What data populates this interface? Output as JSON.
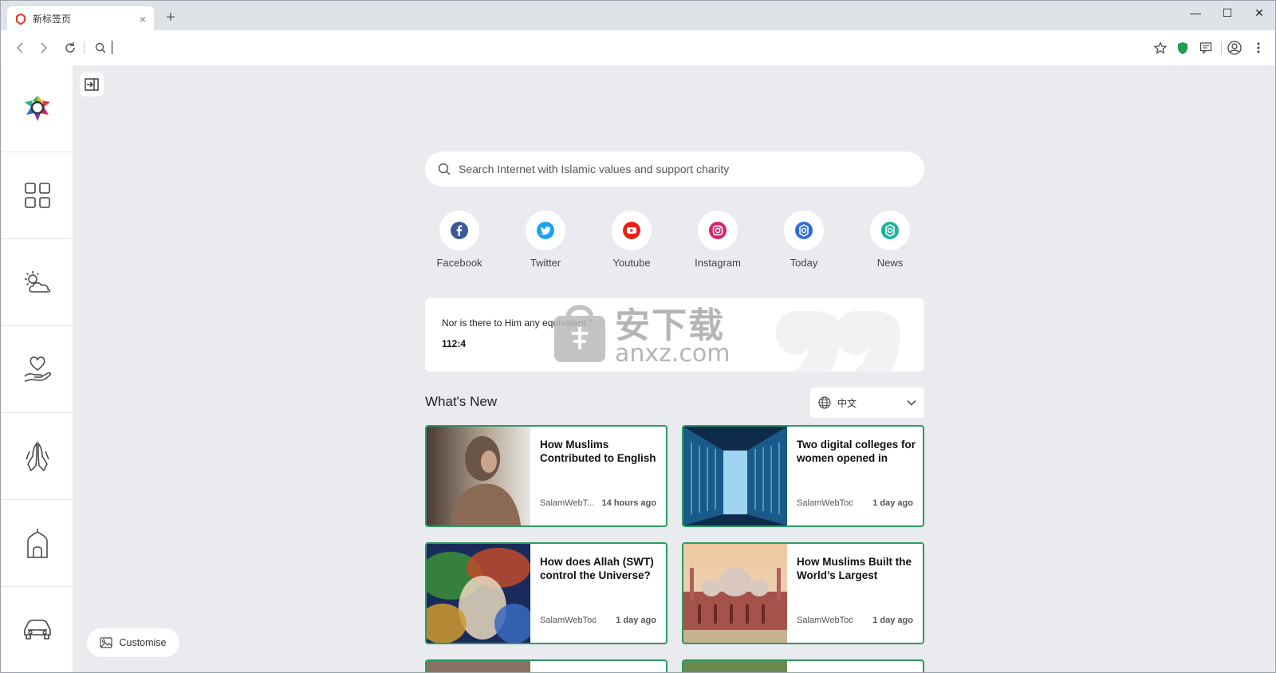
{
  "browser": {
    "tab_title": "新标签页",
    "tab_close": "×",
    "new_tab": "+",
    "window_controls": {
      "minimize": "—",
      "maximize": "☐",
      "close": "✕"
    },
    "address_value": ""
  },
  "toolbar_icons": [
    "back-icon",
    "forward-icon",
    "reload-icon",
    "search-icon",
    "star-icon",
    "shield-icon",
    "chat-icon",
    "account-icon",
    "menu-icon"
  ],
  "sidebar": {
    "items": [
      {
        "name": "logo",
        "icon": "salam-logo-icon"
      },
      {
        "name": "apps",
        "icon": "grid-icon"
      },
      {
        "name": "weather",
        "icon": "weather-icon"
      },
      {
        "name": "charity",
        "icon": "heart-hand-icon"
      },
      {
        "name": "prayer",
        "icon": "praying-hands-icon"
      },
      {
        "name": "mosque",
        "icon": "mosque-icon"
      },
      {
        "name": "car",
        "icon": "car-icon"
      }
    ]
  },
  "search": {
    "placeholder": "Search Internet with Islamic values and support charity"
  },
  "shortcuts": [
    {
      "label": "Facebook",
      "color": "#3b5998"
    },
    {
      "label": "Twitter",
      "color": "#1da1f2"
    },
    {
      "label": "Youtube",
      "color": "#e62117"
    },
    {
      "label": "Instagram",
      "color": "#d6246e"
    },
    {
      "label": "Today",
      "color": "#2f6bd6"
    },
    {
      "label": "News",
      "color": "#1bb39a"
    }
  ],
  "verse": {
    "text": "Nor is there to Him any equivalent.\"",
    "reference": "112:4"
  },
  "watermark": {
    "text_cn": "安下载",
    "text_en": "anxz.com"
  },
  "whats_new": {
    "title": "What's New",
    "language": "中文",
    "cards": [
      {
        "title": "How Muslims Contributed to English",
        "source": "SalamWebT...",
        "time": "14 hours ago"
      },
      {
        "title": "Two digital colleges for women opened in",
        "source": "SalamWebToday",
        "time": "1 day ago"
      },
      {
        "title": "How does Allah (SWT) control the Universe?",
        "source": "SalamWebToday",
        "time": "1 day ago"
      },
      {
        "title": "How Muslims Built the World’s Largest",
        "source": "SalamWebToday",
        "time": "1 day ago"
      }
    ]
  },
  "customise_label": "Customise",
  "colors": {
    "accent_green": "#2e9a63",
    "background": "#e9ebef"
  }
}
